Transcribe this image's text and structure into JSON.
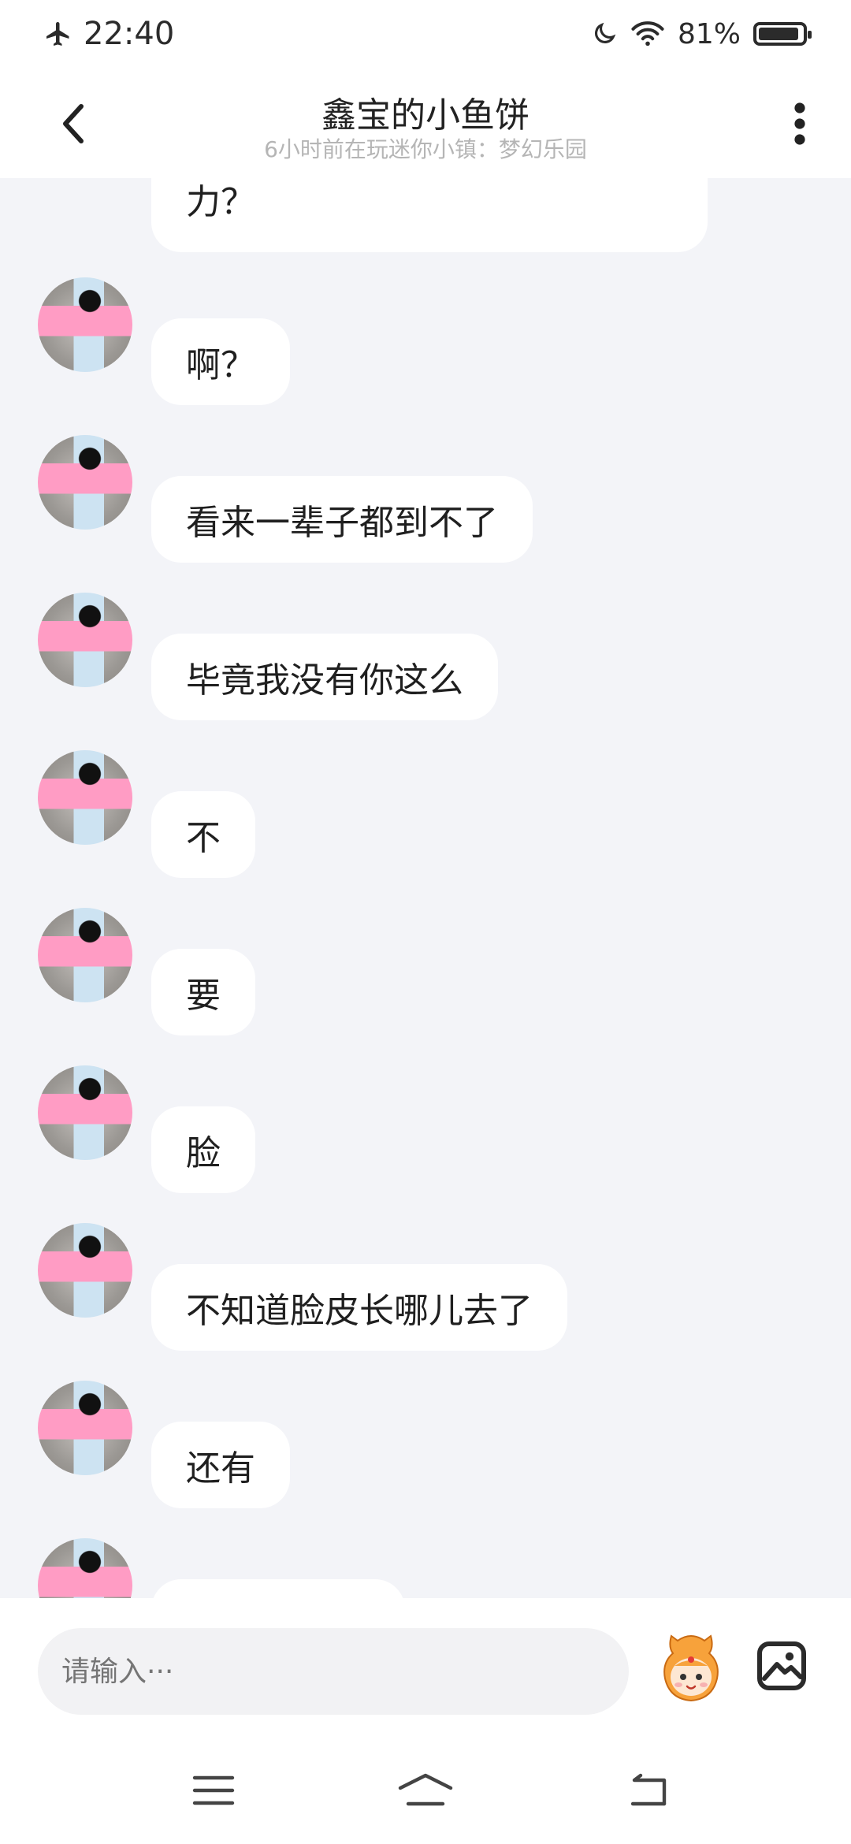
{
  "status_bar": {
    "time": "22:40",
    "battery": "81%",
    "icons": [
      "airplane-icon",
      "moon-icon",
      "wifi-icon",
      "battery-icon"
    ]
  },
  "header": {
    "title": "鑫宝的小鱼饼",
    "subtitle": "6小时前在玩迷你小镇：梦幻乐园"
  },
  "messages": [
    {
      "text": "力？"
    },
    {
      "text": "啊？"
    },
    {
      "text": "看来一辈子都到不了"
    },
    {
      "text": "毕竟我没有你这么"
    },
    {
      "text": "不"
    },
    {
      "text": "要"
    },
    {
      "text": "脸"
    },
    {
      "text": "不知道脸皮长哪儿去了"
    },
    {
      "text": "还有"
    }
  ],
  "input": {
    "placeholder": "请输入···"
  },
  "colors": {
    "background": "#f3f4f8",
    "bubble": "#ffffff",
    "header": "#ffffff"
  }
}
